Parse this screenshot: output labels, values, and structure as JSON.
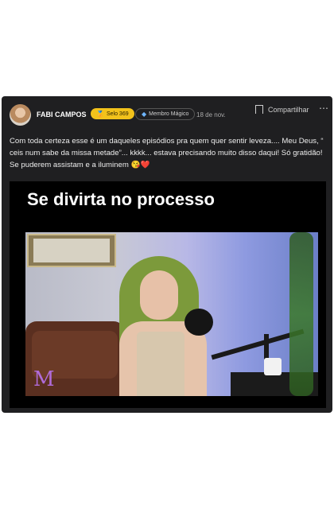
{
  "post": {
    "author": "FABI CAMPOS",
    "badge_selo": "Selo 369",
    "badge_member": "Membro Mágico",
    "date": "18 de nov.",
    "save_label": "Compartilhar",
    "more_label": "⋯",
    "text": "Com toda certeza esse é um daqueles episódios pra quem quer sentir leveza.... Meu Deus, “ ceis num sabe da missa metade”... kkkk... estava precisando muito disso daqui! Só gratidão! Se puderem assistam e a iluminem 😘❤️"
  },
  "video": {
    "caption": "Se divirta no processo",
    "logo_text": "M"
  },
  "colors": {
    "post_bg": "#1f1f21",
    "badge_gold": "#f2c21b",
    "logo_purple": "#b06bd9"
  },
  "icons": {
    "badge_selo": "award-icon",
    "badge_member": "diamond-icon",
    "save": "bookmark-icon",
    "more": "more-horizontal-icon"
  }
}
